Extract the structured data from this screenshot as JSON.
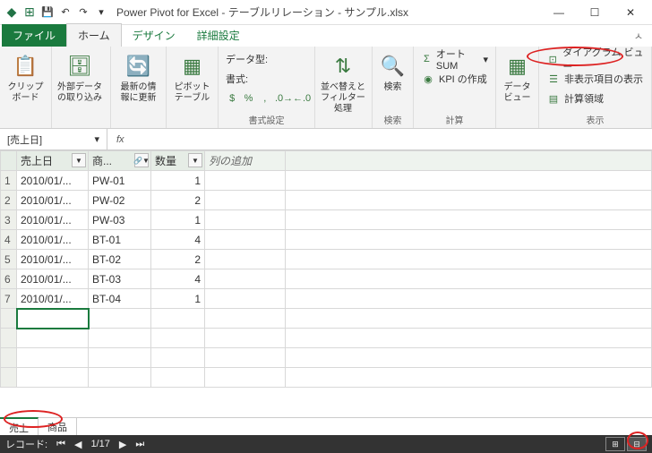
{
  "title": "Power Pivot for Excel - テーブルリレーション - サンプル.xlsx",
  "tabs": {
    "file": "ファイル",
    "home": "ホーム",
    "design": "デザイン",
    "advanced": "詳細設定"
  },
  "ribbon": {
    "clipboard": {
      "label": "クリップボード",
      "btn": "クリップボード"
    },
    "getdata": {
      "label": "外部データの取り込み"
    },
    "refresh": {
      "label": "最新の情報に更新"
    },
    "pivot": {
      "label": "ピボットテーブル"
    },
    "format": {
      "datatype": "データ型:",
      "fmt": "書式:",
      "group": "書式設定"
    },
    "sort": {
      "label": "並べ替えとフィルター処理"
    },
    "search": {
      "btn": "検索",
      "group": "検索"
    },
    "calc": {
      "autosum": "オート SUM",
      "kpi": "KPI の作成",
      "group": "計算"
    },
    "view": {
      "dataview": "データビュー",
      "diagram": "ダイアグラム ビュー",
      "hidden": "非表示項目の表示",
      "calcarea": "計算領域",
      "group": "表示"
    }
  },
  "namebox": "[売上日]",
  "columns": {
    "c1": "売上日",
    "c2": "商...",
    "c3": "数量",
    "add": "列の追加"
  },
  "rows": [
    {
      "n": "1",
      "date": "2010/01/...",
      "prod": "PW-01",
      "qty": "1"
    },
    {
      "n": "2",
      "date": "2010/01/...",
      "prod": "PW-02",
      "qty": "2"
    },
    {
      "n": "3",
      "date": "2010/01/...",
      "prod": "PW-03",
      "qty": "1"
    },
    {
      "n": "4",
      "date": "2010/01/...",
      "prod": "BT-01",
      "qty": "4"
    },
    {
      "n": "5",
      "date": "2010/01/...",
      "prod": "BT-02",
      "qty": "2"
    },
    {
      "n": "6",
      "date": "2010/01/...",
      "prod": "BT-03",
      "qty": "4"
    },
    {
      "n": "7",
      "date": "2010/01/...",
      "prod": "BT-04",
      "qty": "1"
    }
  ],
  "sheets": {
    "s1": "売上",
    "s2": "商品"
  },
  "status": {
    "record": "レコード:",
    "pos": "1/17"
  }
}
